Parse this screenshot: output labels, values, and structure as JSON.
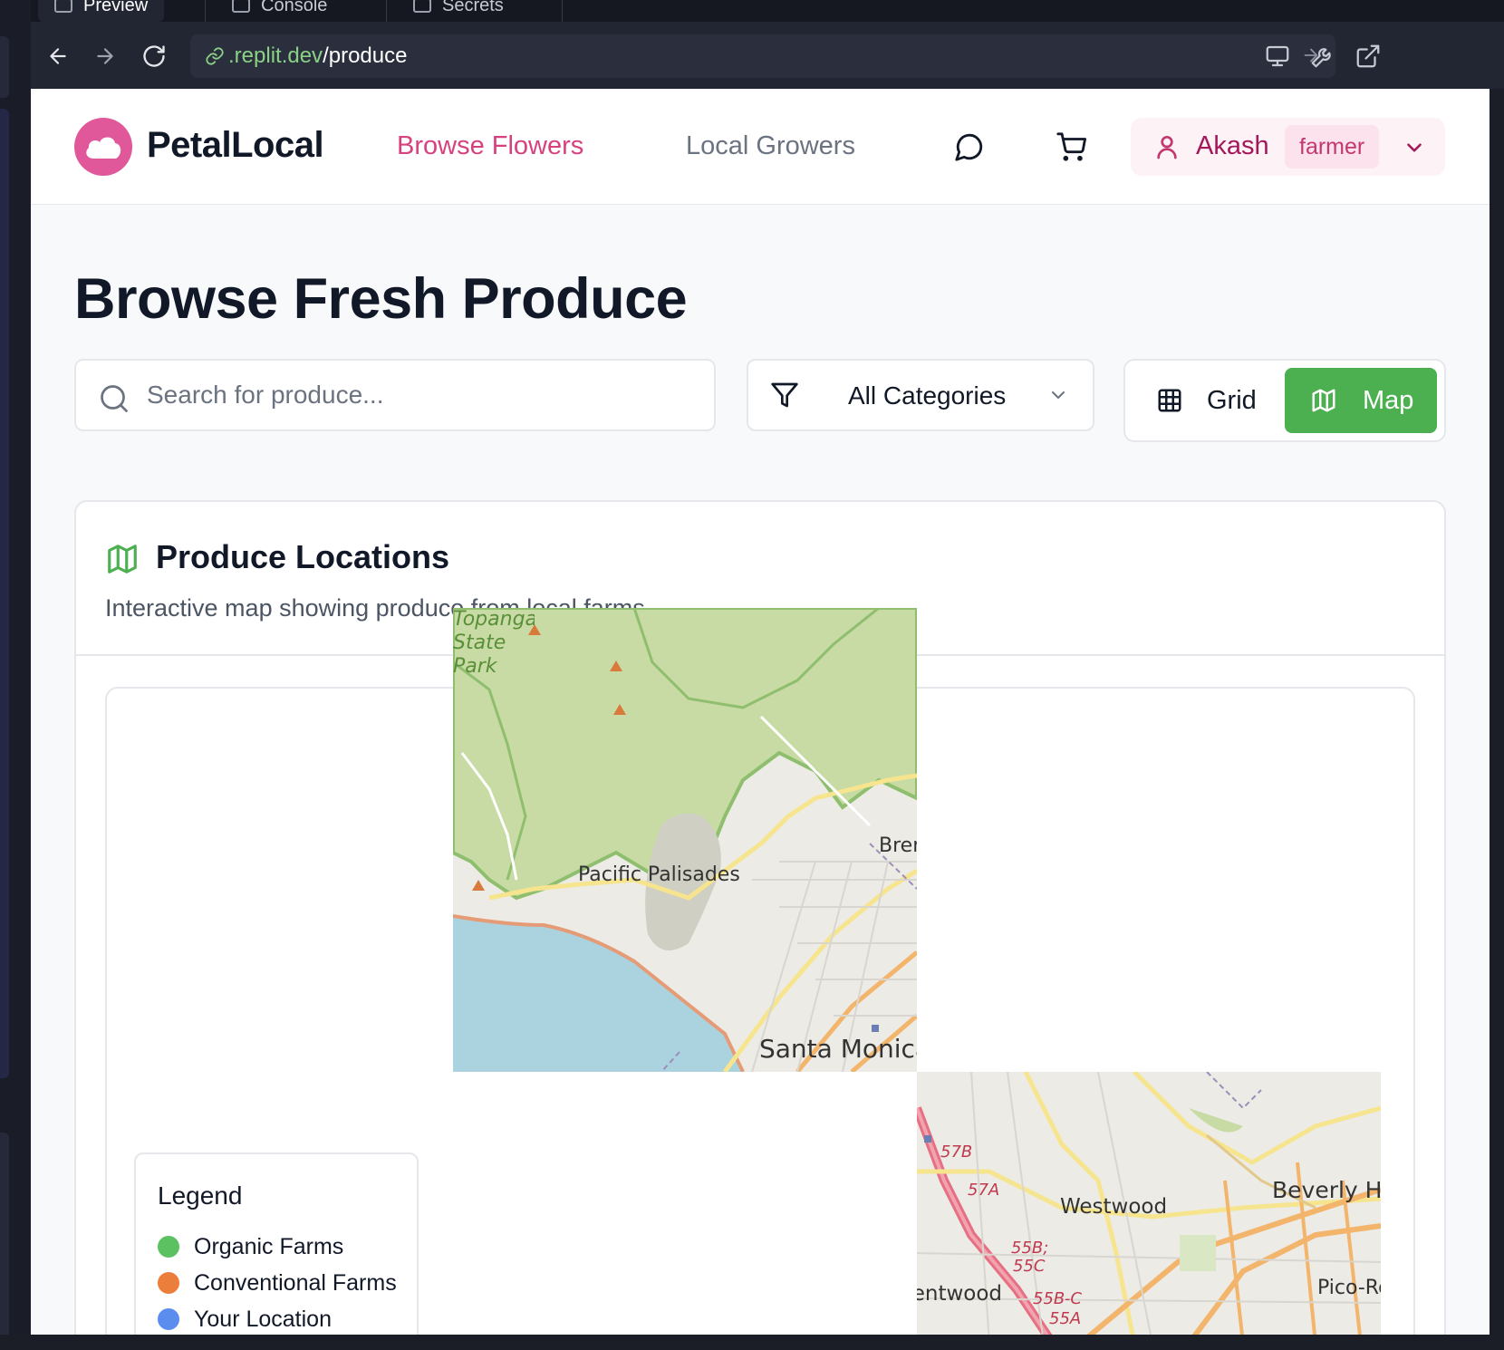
{
  "browser": {
    "tabs": [
      {
        "label": "Preview"
      },
      {
        "label": "Console"
      },
      {
        "label": "Secrets"
      }
    ],
    "url": {
      "host": ".replit.dev",
      "path": "/produce"
    }
  },
  "header": {
    "brand": "PetalLocal",
    "nav": {
      "browse": "Browse Flowers",
      "growers": "Local Growers"
    },
    "user": {
      "name": "Akash",
      "role": "farmer"
    }
  },
  "main": {
    "title": "Browse Fresh Produce",
    "search": {
      "placeholder": "Search for produce...",
      "value": ""
    },
    "category": {
      "selected": "All Categories"
    },
    "view": {
      "grid": "Grid",
      "map": "Map",
      "active": "map"
    }
  },
  "map_card": {
    "title": "Produce Locations",
    "subtitle": "Interactive map showing produce from local farms"
  },
  "map": {
    "labels": {
      "topanga": "Topanga State Park",
      "palisades": "Pacific Palisades",
      "brentwood_top": "Brentwood",
      "santa_monica": "Santa Monica",
      "westwood": "Westwood",
      "beverly_hills": "Beverly Hills",
      "brentwood_bottom": "Brentwood",
      "pico": "Pico-Robertson",
      "exit_57b": "57B",
      "exit_57a": "57A",
      "exit_55b": "55B;",
      "exit_55c": "55C",
      "exit_55bc": "55B-C",
      "exit_55a": "55A"
    }
  },
  "legend": {
    "title": "Legend",
    "items": [
      {
        "label": "Organic Farms",
        "color": "#5cc160"
      },
      {
        "label": "Conventional Farms",
        "color": "#ec7e3c"
      },
      {
        "label": "Your Location",
        "color": "#5b8def"
      }
    ]
  },
  "colors": {
    "brand_pink": "#d6427f",
    "map_green": "#4caf50",
    "water": "#aad3df",
    "park": "#c8dba4",
    "land": "#ecebe6"
  }
}
